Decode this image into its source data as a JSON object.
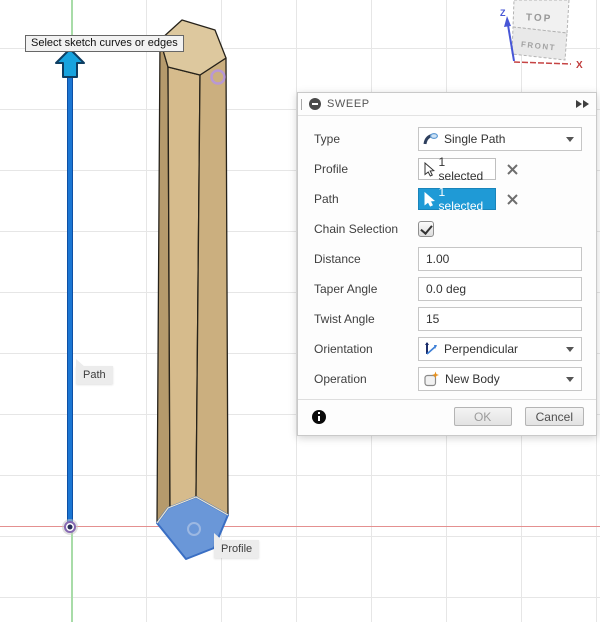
{
  "colors": {
    "selection_blue": "#1f9ad6",
    "path_blue": "#1b76d3",
    "profile_face_blue": "#6a97d8",
    "body_tan": "#d6bb8c",
    "axis_red": "#e49090",
    "axis_green": "#a8dca8"
  },
  "viewport": {
    "tooltip": "Select sketch curves or edges",
    "path_tag": "Path",
    "profile_tag": "Profile",
    "viewcube": {
      "top_face": "TOP",
      "front_face": "FRONT",
      "x_axis": "X",
      "z_axis": "Z"
    }
  },
  "dialog": {
    "title": "SWEEP",
    "rows": {
      "type": {
        "label": "Type",
        "value": "Single Path"
      },
      "profile": {
        "label": "Profile",
        "value": "1 selected"
      },
      "path": {
        "label": "Path",
        "value": "1 selected"
      },
      "chain_selection": {
        "label": "Chain Selection",
        "checked": true
      },
      "distance": {
        "label": "Distance",
        "value": "1.00"
      },
      "taper_angle": {
        "label": "Taper Angle",
        "value": "0.0 deg"
      },
      "twist_angle": {
        "label": "Twist Angle",
        "value": "15"
      },
      "orientation": {
        "label": "Orientation",
        "value": "Perpendicular"
      },
      "operation": {
        "label": "Operation",
        "value": "New Body"
      }
    },
    "buttons": {
      "ok": "OK",
      "cancel": "Cancel"
    }
  }
}
